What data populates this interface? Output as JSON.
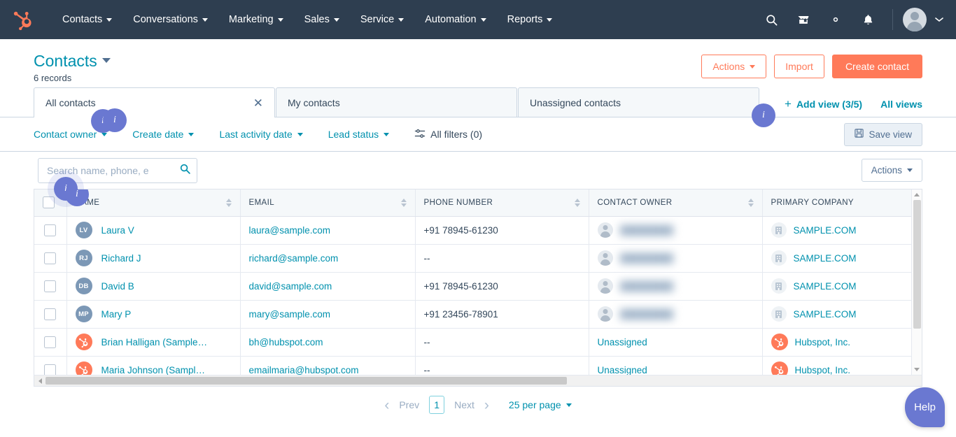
{
  "topnav": {
    "logo_icon": "hubspot-sprocket-logo",
    "items": [
      {
        "label": "Contacts",
        "icon": "chevron-down-icon"
      },
      {
        "label": "Conversations",
        "icon": "chevron-down-icon"
      },
      {
        "label": "Marketing",
        "icon": "chevron-down-icon"
      },
      {
        "label": "Sales",
        "icon": "chevron-down-icon"
      },
      {
        "label": "Service",
        "icon": "chevron-down-icon"
      },
      {
        "label": "Automation",
        "icon": "chevron-down-icon"
      },
      {
        "label": "Reports",
        "icon": "chevron-down-icon"
      }
    ],
    "icons": [
      {
        "name": "search-icon"
      },
      {
        "name": "marketplace-icon"
      },
      {
        "name": "settings-gear-icon"
      },
      {
        "name": "notifications-bell-icon"
      }
    ],
    "avatar_icon": "user-avatar",
    "avatar_caret_icon": "chevron-down-icon",
    "background_color": "#2e3e50"
  },
  "header": {
    "title": "Contacts",
    "title_caret_icon": "caret-down-icon",
    "record_count": "6 records",
    "actions_label": "Actions",
    "import_label": "Import",
    "create_label": "Create contact",
    "accent_color": "#ff7a59",
    "link_color": "#0091ae"
  },
  "views": {
    "tabs": [
      {
        "label": "All contacts",
        "active": true,
        "close_icon": "close-icon"
      },
      {
        "label": "My contacts",
        "active": false
      },
      {
        "label": "Unassigned contacts",
        "active": false
      }
    ],
    "add_view_label": "Add view (3/5)",
    "add_view_icon": "plus-icon",
    "all_views_label": "All views"
  },
  "filters": {
    "items": [
      {
        "label": "Contact owner",
        "icon": "caret-down-icon"
      },
      {
        "label": "Create date",
        "icon": "caret-down-icon"
      },
      {
        "label": "Last activity date",
        "icon": "caret-down-icon"
      },
      {
        "label": "Lead status",
        "icon": "caret-down-icon"
      }
    ],
    "all_filters_label": "All filters (0)",
    "all_filters_icon": "sliders-icon",
    "save_view_label": "Save view",
    "save_view_icon": "save-disk-icon"
  },
  "toolbar": {
    "search_placeholder": "Search name, phone, e",
    "search_value": "",
    "search_icon": "search-icon",
    "actions_label": "Actions",
    "actions_caret_icon": "caret-down-icon"
  },
  "table": {
    "select_all_icon": "checkbox-unchecked",
    "columns": [
      {
        "key": "name",
        "label": "NAME",
        "sortable": true
      },
      {
        "key": "email",
        "label": "EMAIL",
        "sortable": true
      },
      {
        "key": "phone",
        "label": "PHONE NUMBER",
        "sortable": true
      },
      {
        "key": "owner",
        "label": "CONTACT OWNER",
        "sortable": true
      },
      {
        "key": "company",
        "label": "PRIMARY COMPANY",
        "sortable": false
      }
    ],
    "rows": [
      {
        "initials": "LV",
        "avatar_type": "initials",
        "name": "Laura V",
        "email": "laura@sample.com",
        "phone": "+91 78945-61230",
        "owner": "",
        "owner_blurred": true,
        "company": "SAMPLE.COM",
        "company_icon": "building-icon"
      },
      {
        "initials": "RJ",
        "avatar_type": "initials",
        "name": "Richard J",
        "email": "richard@sample.com",
        "phone": "--",
        "owner": "",
        "owner_blurred": true,
        "company": "SAMPLE.COM",
        "company_icon": "building-icon"
      },
      {
        "initials": "DB",
        "avatar_type": "initials",
        "name": "David B",
        "email": "david@sample.com",
        "phone": "+91 78945-61230",
        "owner": "",
        "owner_blurred": true,
        "company": "SAMPLE.COM",
        "company_icon": "building-icon"
      },
      {
        "initials": "MP",
        "avatar_type": "initials",
        "name": "Mary P",
        "email": "mary@sample.com",
        "phone": "+91 23456-78901",
        "owner": "",
        "owner_blurred": true,
        "company": "SAMPLE.COM",
        "company_icon": "building-icon"
      },
      {
        "initials": "",
        "avatar_type": "hubspot",
        "name": "Brian Halligan (Sample…",
        "email": "bh@hubspot.com",
        "phone": "--",
        "owner": "Unassigned",
        "owner_blurred": false,
        "company": "Hubspot, Inc.",
        "company_icon": "hubspot-sprocket-icon"
      },
      {
        "initials": "",
        "avatar_type": "hubspot",
        "name": "Maria Johnson (Sampl…",
        "email": "emailmaria@hubspot.com",
        "phone": "--",
        "owner": "Unassigned",
        "owner_blurred": false,
        "company": "Hubspot, Inc.",
        "company_icon": "hubspot-sprocket-icon"
      }
    ]
  },
  "pagination": {
    "prev_chevron_icon": "chevron-left-icon",
    "prev_label": "Prev",
    "current_page": "1",
    "next_label": "Next",
    "next_chevron_icon": "chevron-right-icon",
    "per_page_label": "25 per page",
    "per_page_caret_icon": "caret-down-icon"
  },
  "overlays": {
    "help_label": "Help",
    "help_color": "#6a78d1",
    "info_badge_label": "i",
    "badges": [
      {
        "name": "info-badge-import"
      },
      {
        "name": "info-badge-tabs"
      },
      {
        "name": "info-badge-filters"
      },
      {
        "name": "info-badge-search"
      },
      {
        "name": "info-badge-table-header"
      }
    ]
  }
}
